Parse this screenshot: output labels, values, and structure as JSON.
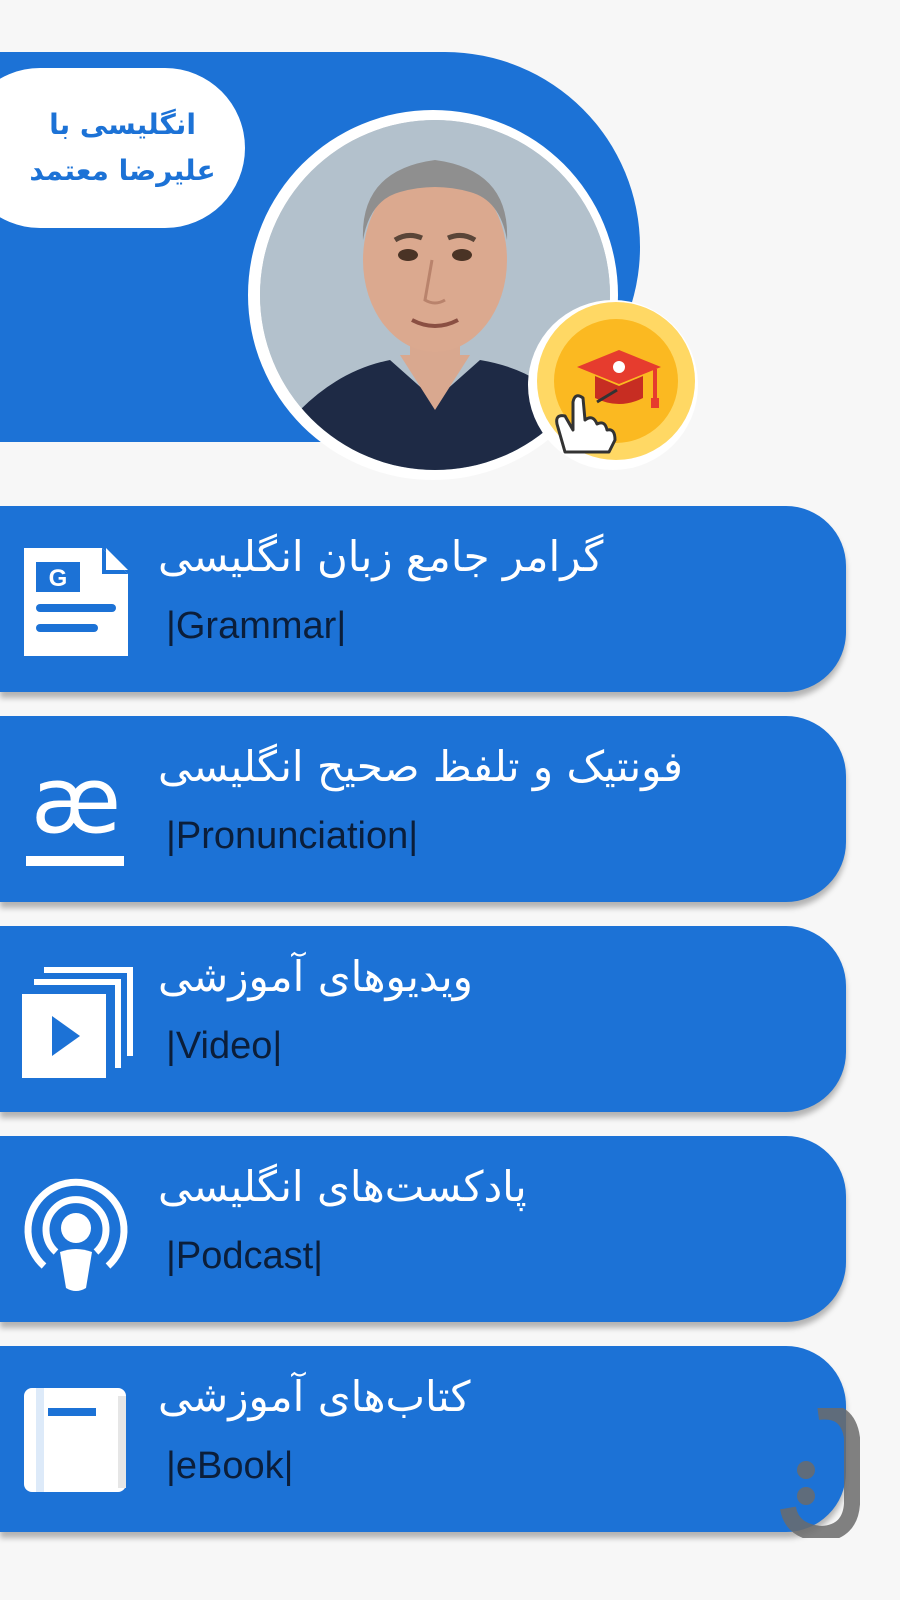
{
  "header": {
    "title_line1": "انگلیسی با",
    "title_line2": "علیرضا معتمد"
  },
  "avatar": {
    "icon": "avatar-photo"
  },
  "badge": {
    "icon": "graduation-cap-tap-icon"
  },
  "menu": [
    {
      "title": "گرامر جامع زبان انگلیسی",
      "subtitle": "|Grammar|",
      "icon": "grammar-document-icon"
    },
    {
      "title": "فونتیک و تلفظ صحیح انگلیسی",
      "subtitle": "|Pronunciation|",
      "icon": "phonetic-ae-icon"
    },
    {
      "title": "ویدیوهای آموزشی",
      "subtitle": "|Video|",
      "icon": "video-stack-icon"
    },
    {
      "title": "پادکست‌های انگلیسی",
      "subtitle": "|Podcast|",
      "icon": "podcast-icon"
    },
    {
      "title": "کتاب‌های آموزشی",
      "subtitle": "|eBook|",
      "icon": "ebook-icon"
    }
  ],
  "colors": {
    "primary": "#1c72d6",
    "badge": "#fbb921",
    "subtitle_text": "#0b1e3a"
  },
  "store_logo": {
    "icon": "store-watermark-icon"
  }
}
